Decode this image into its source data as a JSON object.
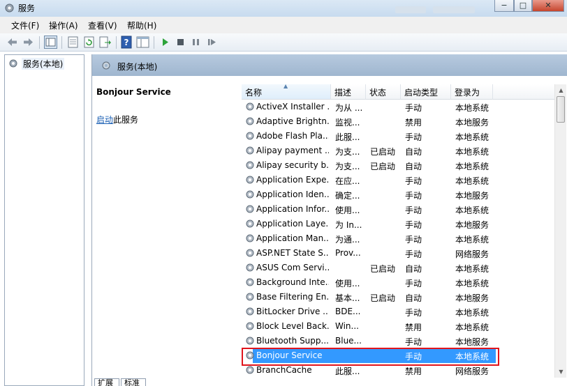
{
  "window": {
    "title": "服务",
    "controls": [
      "−",
      "□",
      "✕"
    ]
  },
  "menu": [
    "文件(F)",
    "操作(A)",
    "查看(V)",
    "帮助(H)"
  ],
  "tree": {
    "root_label": "服务(本地)"
  },
  "pane": {
    "header_title": "服务(本地)",
    "selected_service": "Bonjour Service",
    "start_link": "启动",
    "start_suffix": "此服务"
  },
  "columns": [
    "名称",
    "描述",
    "状态",
    "启动类型",
    "登录为"
  ],
  "services": [
    {
      "name": "ActiveX Installer ...",
      "desc": "为从 ...",
      "status": "",
      "startup": "手动",
      "logon": "本地系统"
    },
    {
      "name": "Adaptive Brightn...",
      "desc": "监视...",
      "status": "",
      "startup": "禁用",
      "logon": "本地服务"
    },
    {
      "name": "Adobe Flash Pla...",
      "desc": "此服...",
      "status": "",
      "startup": "手动",
      "logon": "本地系统"
    },
    {
      "name": "Alipay payment ...",
      "desc": "为支...",
      "status": "已启动",
      "startup": "自动",
      "logon": "本地系统"
    },
    {
      "name": "Alipay security b...",
      "desc": "为支...",
      "status": "已启动",
      "startup": "自动",
      "logon": "本地系统"
    },
    {
      "name": "Application Expe...",
      "desc": "在应...",
      "status": "",
      "startup": "手动",
      "logon": "本地系统"
    },
    {
      "name": "Application Iden...",
      "desc": "确定...",
      "status": "",
      "startup": "手动",
      "logon": "本地服务"
    },
    {
      "name": "Application Infor...",
      "desc": "使用...",
      "status": "",
      "startup": "手动",
      "logon": "本地系统"
    },
    {
      "name": "Application Laye...",
      "desc": "为 In...",
      "status": "",
      "startup": "手动",
      "logon": "本地服务"
    },
    {
      "name": "Application Man...",
      "desc": "为通...",
      "status": "",
      "startup": "手动",
      "logon": "本地系统"
    },
    {
      "name": "ASP.NET State S...",
      "desc": "Prov...",
      "status": "",
      "startup": "手动",
      "logon": "网络服务"
    },
    {
      "name": "ASUS Com Servi...",
      "desc": "",
      "status": "已启动",
      "startup": "自动",
      "logon": "本地系统"
    },
    {
      "name": "Background Inte...",
      "desc": "使用...",
      "status": "",
      "startup": "手动",
      "logon": "本地系统"
    },
    {
      "name": "Base Filtering En...",
      "desc": "基本...",
      "status": "已启动",
      "startup": "自动",
      "logon": "本地服务"
    },
    {
      "name": "BitLocker Drive ...",
      "desc": "BDE...",
      "status": "",
      "startup": "手动",
      "logon": "本地系统"
    },
    {
      "name": "Block Level Back...",
      "desc": "Win...",
      "status": "",
      "startup": "禁用",
      "logon": "本地系统"
    },
    {
      "name": "Bluetooth Supp...",
      "desc": "Blue...",
      "status": "",
      "startup": "手动",
      "logon": "本地服务"
    },
    {
      "name": "Bonjour Service",
      "desc": "",
      "status": "",
      "startup": "手动",
      "logon": "本地系统"
    },
    {
      "name": "BranchCache",
      "desc": "此服...",
      "status": "",
      "startup": "禁用",
      "logon": "网络服务"
    }
  ],
  "selected_index": 17,
  "bottom_tabs": [
    "扩展",
    "标准"
  ]
}
